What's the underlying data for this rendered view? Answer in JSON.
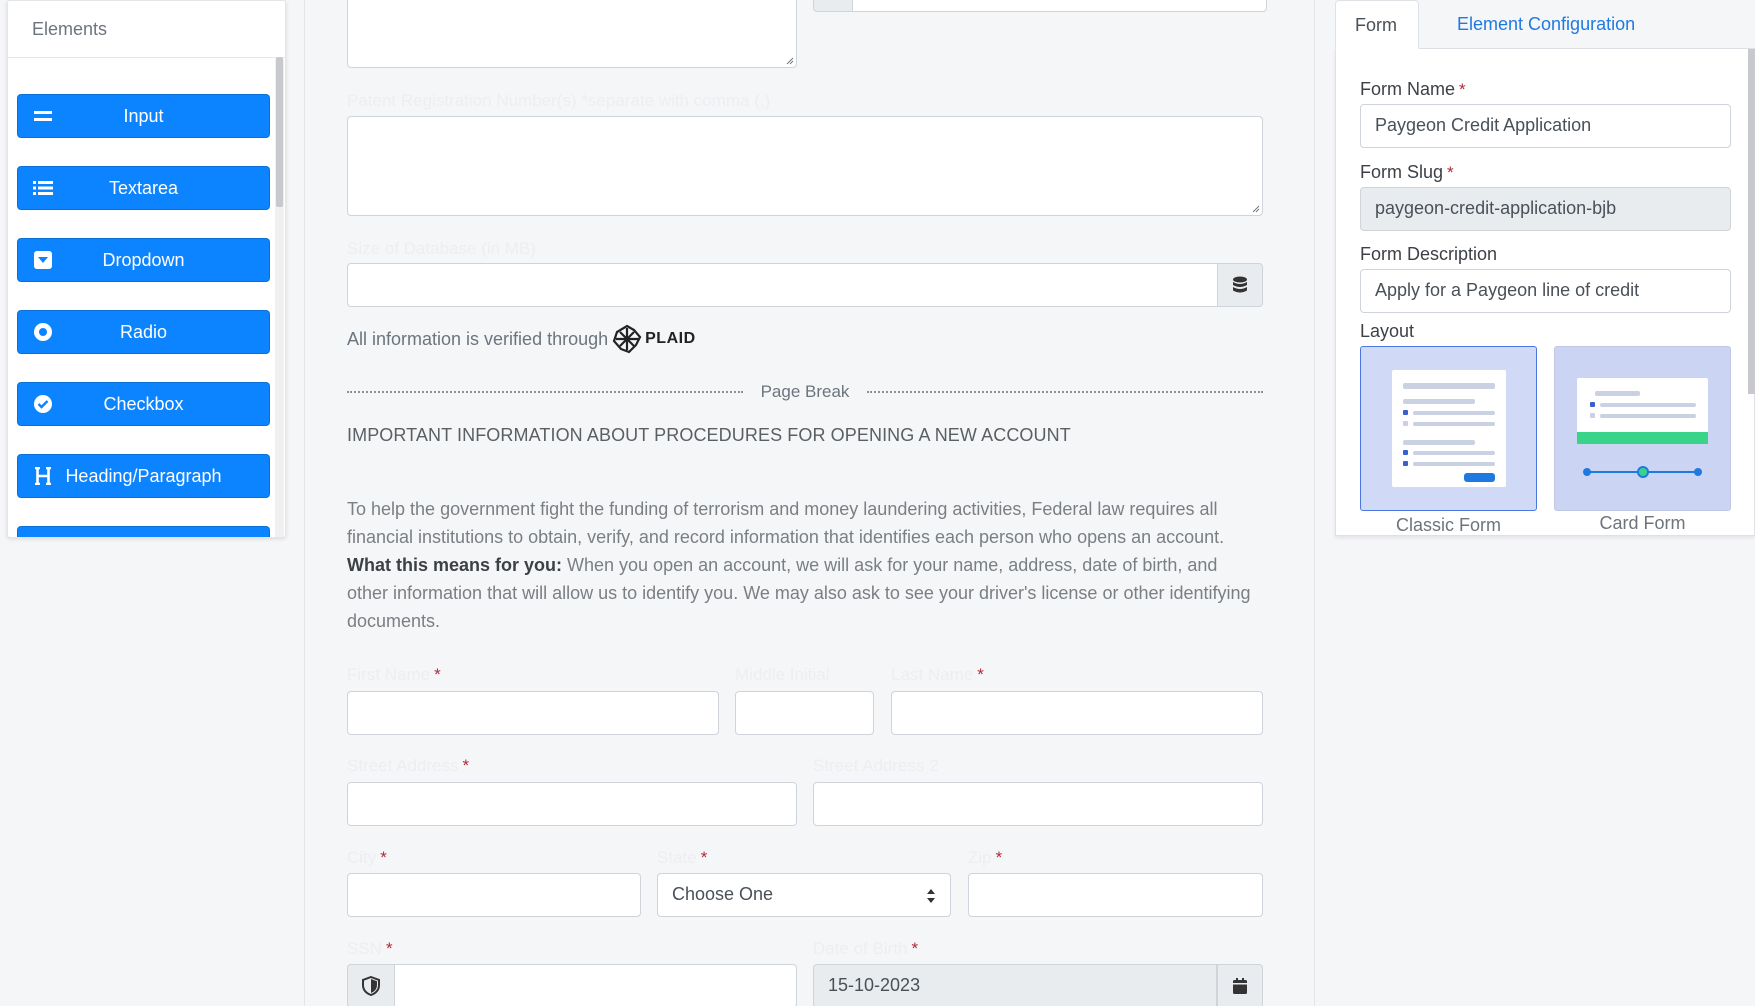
{
  "elements_panel": {
    "title": "Elements",
    "items": [
      {
        "label": "Input",
        "icon": "equals-icon"
      },
      {
        "label": "Textarea",
        "icon": "list-icon"
      },
      {
        "label": "Dropdown",
        "icon": "caret-square-down-icon"
      },
      {
        "label": "Radio",
        "icon": "dot-circle-icon"
      },
      {
        "label": "Checkbox",
        "icon": "check-circle-icon"
      },
      {
        "label": "Heading/Paragraph",
        "icon": "heading-icon"
      }
    ]
  },
  "form_canvas": {
    "patent_label": "Patent Registration Number(s) *separate with comma (,)",
    "database_label": "Size of Database (in MB)",
    "plaid_text": "All information is verified through",
    "plaid_brand": "PLAID",
    "page_break": "Page Break",
    "heading": "IMPORTANT INFORMATION ABOUT PROCEDURES FOR OPENING A NEW ACCOUNT",
    "para_part1": "To help the government fight the funding of terrorism and money laundering activities, Federal law requires all financial institutions to obtain, verify, and record information that identifies each person who opens an account. ",
    "para_bold": "What this means for you:",
    "para_part2": " When you open an account, we will ask for your name, address, date of birth, and other information that will allow us to identify you. We may also ask to see your driver's license or other identifying documents.",
    "first_name_label": "First Name",
    "middle_initial_label": "Middle Initial",
    "last_name_label": "Last Name",
    "street1_label": "Street Address",
    "street2_label": "Street Address 2",
    "city_label": "City",
    "state_label": "State",
    "state_value": "Choose One",
    "zip_label": "Zip",
    "ssn_label": "SSN",
    "dob_label": "Date of Birth",
    "dob_value": "15-10-2023",
    "required_mark": "*"
  },
  "config_panel": {
    "tabs": [
      "Form",
      "Element Configuration"
    ],
    "form_name_label": "Form Name",
    "form_name_value": "Paygeon Credit Application",
    "form_slug_label": "Form Slug",
    "form_slug_value": "paygeon-credit-application-bjb",
    "form_desc_label": "Form Description",
    "form_desc_value": "Apply for a Paygeon line of credit",
    "layout_label": "Layout",
    "layouts": [
      "Classic Form",
      "Card Form"
    ],
    "required_mark": "*"
  },
  "colors": {
    "primary_button": "#0d84ff",
    "link": "#1f7ae0",
    "required": "#b02a37",
    "layout_selected_border": "#4a78e0"
  }
}
